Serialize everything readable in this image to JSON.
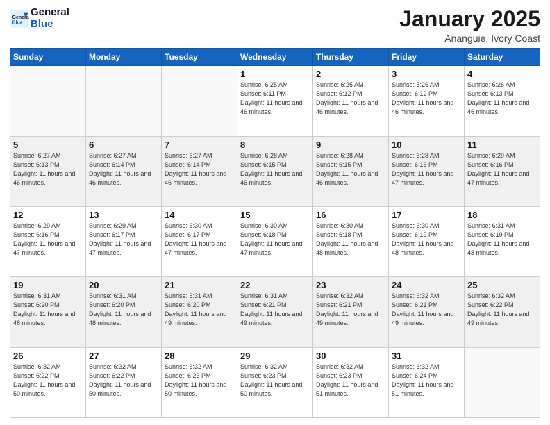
{
  "logo": {
    "text_general": "General",
    "text_blue": "Blue"
  },
  "header": {
    "month": "January 2025",
    "location": "Ananguie, Ivory Coast"
  },
  "weekdays": [
    "Sunday",
    "Monday",
    "Tuesday",
    "Wednesday",
    "Thursday",
    "Friday",
    "Saturday"
  ],
  "weeks": [
    [
      {
        "day": "",
        "empty": true
      },
      {
        "day": "",
        "empty": true
      },
      {
        "day": "",
        "empty": true
      },
      {
        "day": "1",
        "sunrise": "6:25 AM",
        "sunset": "6:11 PM",
        "daylight": "11 hours and 46 minutes."
      },
      {
        "day": "2",
        "sunrise": "6:25 AM",
        "sunset": "6:12 PM",
        "daylight": "11 hours and 46 minutes."
      },
      {
        "day": "3",
        "sunrise": "6:26 AM",
        "sunset": "6:12 PM",
        "daylight": "11 hours and 46 minutes."
      },
      {
        "day": "4",
        "sunrise": "6:26 AM",
        "sunset": "6:13 PM",
        "daylight": "11 hours and 46 minutes."
      }
    ],
    [
      {
        "day": "5",
        "sunrise": "6:27 AM",
        "sunset": "6:13 PM",
        "daylight": "11 hours and 46 minutes."
      },
      {
        "day": "6",
        "sunrise": "6:27 AM",
        "sunset": "6:14 PM",
        "daylight": "11 hours and 46 minutes."
      },
      {
        "day": "7",
        "sunrise": "6:27 AM",
        "sunset": "6:14 PM",
        "daylight": "11 hours and 46 minutes."
      },
      {
        "day": "8",
        "sunrise": "6:28 AM",
        "sunset": "6:15 PM",
        "daylight": "11 hours and 46 minutes."
      },
      {
        "day": "9",
        "sunrise": "6:28 AM",
        "sunset": "6:15 PM",
        "daylight": "11 hours and 46 minutes."
      },
      {
        "day": "10",
        "sunrise": "6:28 AM",
        "sunset": "6:16 PM",
        "daylight": "11 hours and 47 minutes."
      },
      {
        "day": "11",
        "sunrise": "6:29 AM",
        "sunset": "6:16 PM",
        "daylight": "11 hours and 47 minutes."
      }
    ],
    [
      {
        "day": "12",
        "sunrise": "6:29 AM",
        "sunset": "6:16 PM",
        "daylight": "11 hours and 47 minutes."
      },
      {
        "day": "13",
        "sunrise": "6:29 AM",
        "sunset": "6:17 PM",
        "daylight": "11 hours and 47 minutes."
      },
      {
        "day": "14",
        "sunrise": "6:30 AM",
        "sunset": "6:17 PM",
        "daylight": "11 hours and 47 minutes."
      },
      {
        "day": "15",
        "sunrise": "6:30 AM",
        "sunset": "6:18 PM",
        "daylight": "11 hours and 47 minutes."
      },
      {
        "day": "16",
        "sunrise": "6:30 AM",
        "sunset": "6:18 PM",
        "daylight": "11 hours and 48 minutes."
      },
      {
        "day": "17",
        "sunrise": "6:30 AM",
        "sunset": "6:19 PM",
        "daylight": "11 hours and 48 minutes."
      },
      {
        "day": "18",
        "sunrise": "6:31 AM",
        "sunset": "6:19 PM",
        "daylight": "11 hours and 48 minutes."
      }
    ],
    [
      {
        "day": "19",
        "sunrise": "6:31 AM",
        "sunset": "6:20 PM",
        "daylight": "11 hours and 48 minutes."
      },
      {
        "day": "20",
        "sunrise": "6:31 AM",
        "sunset": "6:20 PM",
        "daylight": "11 hours and 48 minutes."
      },
      {
        "day": "21",
        "sunrise": "6:31 AM",
        "sunset": "6:20 PM",
        "daylight": "11 hours and 49 minutes."
      },
      {
        "day": "22",
        "sunrise": "6:31 AM",
        "sunset": "6:21 PM",
        "daylight": "11 hours and 49 minutes."
      },
      {
        "day": "23",
        "sunrise": "6:32 AM",
        "sunset": "6:21 PM",
        "daylight": "11 hours and 49 minutes."
      },
      {
        "day": "24",
        "sunrise": "6:32 AM",
        "sunset": "6:21 PM",
        "daylight": "11 hours and 49 minutes."
      },
      {
        "day": "25",
        "sunrise": "6:32 AM",
        "sunset": "6:22 PM",
        "daylight": "11 hours and 49 minutes."
      }
    ],
    [
      {
        "day": "26",
        "sunrise": "6:32 AM",
        "sunset": "6:22 PM",
        "daylight": "11 hours and 50 minutes."
      },
      {
        "day": "27",
        "sunrise": "6:32 AM",
        "sunset": "6:22 PM",
        "daylight": "11 hours and 50 minutes."
      },
      {
        "day": "28",
        "sunrise": "6:32 AM",
        "sunset": "6:23 PM",
        "daylight": "11 hours and 50 minutes."
      },
      {
        "day": "29",
        "sunrise": "6:32 AM",
        "sunset": "6:23 PM",
        "daylight": "11 hours and 50 minutes."
      },
      {
        "day": "30",
        "sunrise": "6:32 AM",
        "sunset": "6:23 PM",
        "daylight": "11 hours and 51 minutes."
      },
      {
        "day": "31",
        "sunrise": "6:32 AM",
        "sunset": "6:24 PM",
        "daylight": "11 hours and 51 minutes."
      },
      {
        "day": "",
        "empty": true
      }
    ]
  ]
}
